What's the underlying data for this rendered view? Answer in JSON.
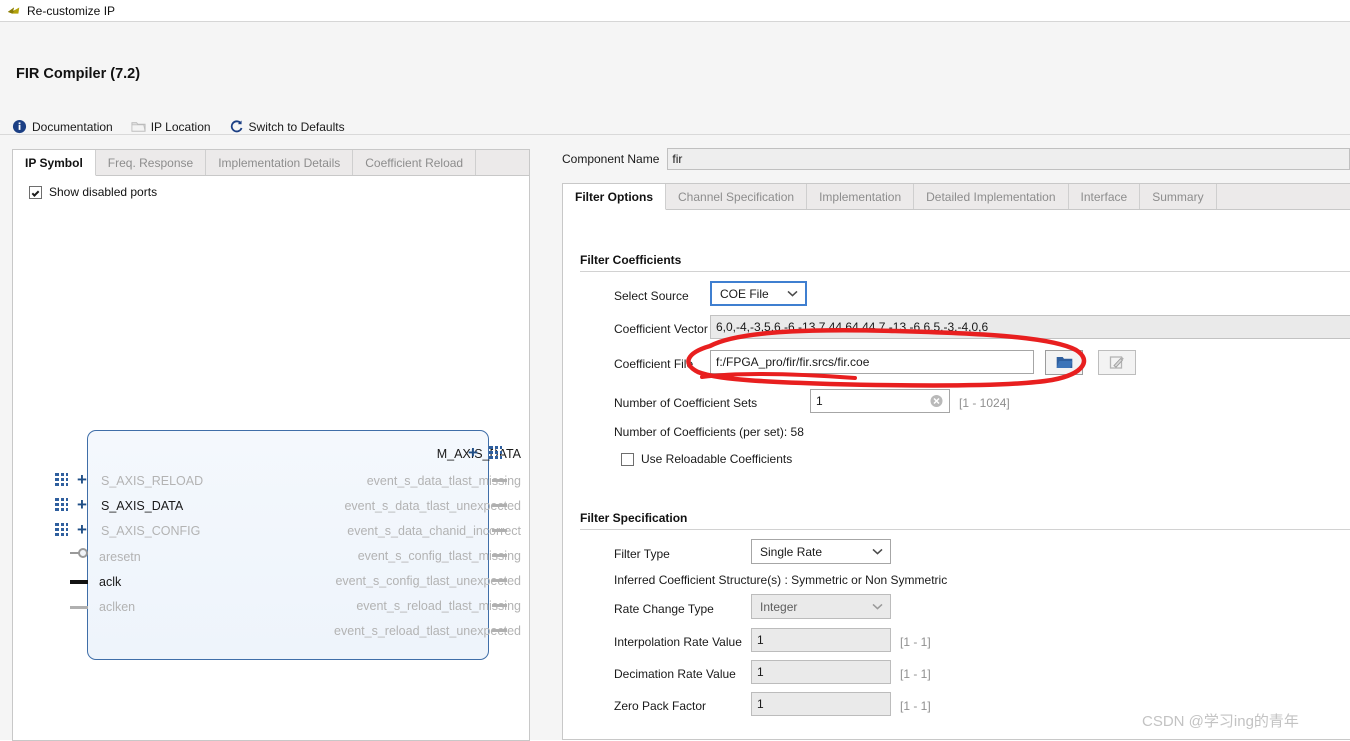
{
  "window": {
    "title": "Re-customize IP",
    "icon": "xilinx-arrow-icon"
  },
  "header": {
    "title": "FIR Compiler (7.2)",
    "links": [
      {
        "label": "Documentation",
        "icon": "info-icon"
      },
      {
        "label": "IP Location",
        "icon": "folder-icon"
      },
      {
        "label": "Switch to Defaults",
        "icon": "refresh-icon"
      }
    ]
  },
  "left_panel": {
    "tabs": [
      {
        "label": "IP Symbol",
        "active": true
      },
      {
        "label": "Freq. Response",
        "active": false
      },
      {
        "label": "Implementation Details",
        "active": false
      },
      {
        "label": "Coefficient Reload",
        "active": false
      }
    ],
    "show_disabled_ports": {
      "label": "Show disabled ports",
      "checked": true
    },
    "symbol": {
      "top_right_port": {
        "label": "M_AXIS_DATA",
        "enabled": true,
        "bus": true
      },
      "left_ports": [
        {
          "label": "S_AXIS_RELOAD",
          "enabled": false,
          "bus": true
        },
        {
          "label": "S_AXIS_DATA",
          "enabled": true,
          "bus": true
        },
        {
          "label": "S_AXIS_CONFIG",
          "enabled": false,
          "bus": true
        },
        {
          "label": "aresetn",
          "enabled": false,
          "bus": false,
          "pin": "active-low"
        },
        {
          "label": "aclk",
          "enabled": true,
          "bus": false,
          "pin": "clock"
        },
        {
          "label": "aclken",
          "enabled": false,
          "bus": false,
          "pin": "plain"
        }
      ],
      "right_ports": [
        {
          "label": "event_s_data_tlast_missing",
          "enabled": false
        },
        {
          "label": "event_s_data_tlast_unexpected",
          "enabled": false
        },
        {
          "label": "event_s_data_chanid_incorrect",
          "enabled": false
        },
        {
          "label": "event_s_config_tlast_missing",
          "enabled": false
        },
        {
          "label": "event_s_config_tlast_unexpected",
          "enabled": false
        },
        {
          "label": "event_s_reload_tlast_missing",
          "enabled": false
        },
        {
          "label": "event_s_reload_tlast_unexpected",
          "enabled": false
        }
      ]
    }
  },
  "right_panel": {
    "component_name": {
      "label": "Component Name",
      "value": "fir"
    },
    "tabs": [
      {
        "label": "Filter Options",
        "active": true
      },
      {
        "label": "Channel Specification",
        "active": false
      },
      {
        "label": "Implementation",
        "active": false
      },
      {
        "label": "Detailed Implementation",
        "active": false
      },
      {
        "label": "Interface",
        "active": false
      },
      {
        "label": "Summary",
        "active": false
      }
    ],
    "filter_coefficients": {
      "group_label": "Filter Coefficients",
      "select_source": {
        "label": "Select Source",
        "value": "COE File",
        "focused": true
      },
      "coefficient_vector": {
        "label": "Coefficient Vector",
        "value": "6,0,-4,-3,5,6,-6,-13,7,44,64,44,7,-13,-6,6,5,-3,-4,0,6"
      },
      "coefficient_file": {
        "label": "Coefficient File",
        "value": "f:/FPGA_pro/fir/fir.srcs/fir.coe",
        "browse_icon": "folder-open-icon",
        "edit_icon": "edit-pencil-icon"
      },
      "number_of_sets": {
        "label": "Number of Coefficient Sets",
        "value": "1",
        "range": "[1 - 1024]",
        "clear_icon": "clear-circle-icon"
      },
      "coefficients_per_set": "Number of Coefficients (per set): 58",
      "use_reloadable": {
        "label": "Use Reloadable Coefficients",
        "checked": false
      }
    },
    "filter_specification": {
      "group_label": "Filter Specification",
      "filter_type": {
        "label": "Filter Type",
        "value": "Single Rate"
      },
      "inferred_structure": "Inferred Coefficient Structure(s) : Symmetric or Non Symmetric",
      "rate_change_type": {
        "label": "Rate Change Type",
        "value": "Integer",
        "disabled": true
      },
      "interpolation_rate": {
        "label": "Interpolation Rate Value",
        "value": "1",
        "range": "[1 - 1]",
        "disabled": true
      },
      "decimation_rate": {
        "label": "Decimation Rate Value",
        "value": "1",
        "range": "[1 - 1]",
        "disabled": true
      },
      "zero_pack_factor": {
        "label": "Zero Pack Factor",
        "value": "1",
        "range": "[1 - 1]",
        "disabled": true
      }
    }
  },
  "annotation": {
    "type": "hand-drawn-red-ellipse",
    "color": "#e81f1f",
    "target": "coefficient-file-field"
  },
  "watermark": "CSDN @学习ing的青年",
  "colors": {
    "accent_blue": "#3f6ea8",
    "focus_blue": "#3f7fd0",
    "annotation_red": "#e81f1f",
    "panel_bg": "#f5f5f5"
  }
}
